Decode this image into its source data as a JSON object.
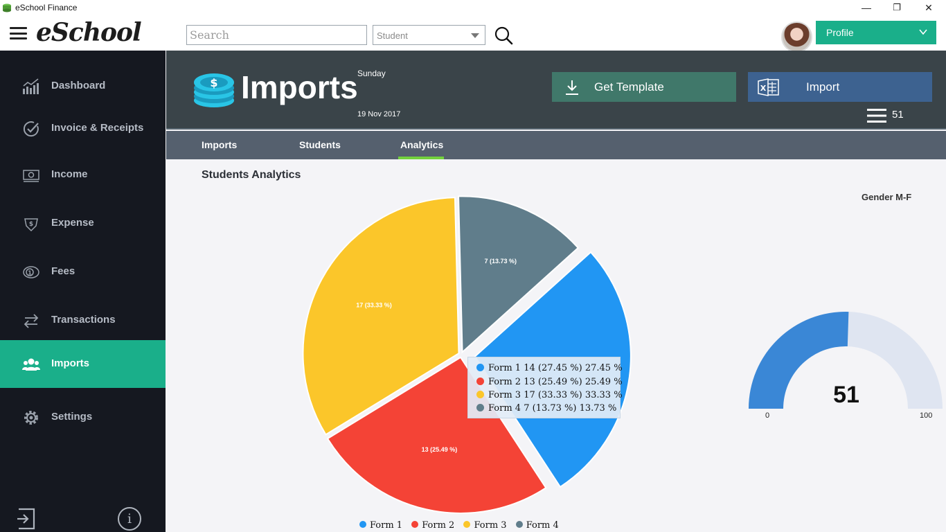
{
  "window": {
    "title": "eSchool Finance",
    "controls": {
      "minimize": "—",
      "maximize": "❐",
      "close": "✕"
    }
  },
  "header": {
    "logo": "eSchool",
    "search_placeholder": "Search",
    "role_select_value": "Student",
    "profile_label": "Profile"
  },
  "sidebar": {
    "items": [
      {
        "label": "Dashboard",
        "icon": "chart-icon",
        "active": false
      },
      {
        "label": "Invoice & Receipts",
        "icon": "check-circle-icon",
        "active": false
      },
      {
        "label": "Income",
        "icon": "money-icon",
        "active": false
      },
      {
        "label": "Expense",
        "icon": "expense-icon",
        "active": false
      },
      {
        "label": "Fees",
        "icon": "coin-icon",
        "active": false
      },
      {
        "label": "Transactions",
        "icon": "transfer-icon",
        "active": false
      },
      {
        "label": "Imports",
        "icon": "users-icon",
        "active": true
      },
      {
        "label": "Settings",
        "icon": "gear-icon",
        "active": false
      }
    ],
    "info_glyph": "i"
  },
  "banner": {
    "title": "Imports",
    "day": "Sunday",
    "date": "19 Nov 2017",
    "template_button": "Get Template",
    "import_button": "Import",
    "record_count": "51"
  },
  "tabs": [
    {
      "label": "Imports",
      "active": false
    },
    {
      "label": "Students",
      "active": false
    },
    {
      "label": "Analytics",
      "active": true
    }
  ],
  "content": {
    "section_title": "Students Analytics",
    "gauge_title": "Gender M-F",
    "gauge_value": "51",
    "gauge_min": "0",
    "gauge_max": "100"
  },
  "colors": {
    "accent_green": "#1aaf8a",
    "form1": "#2196f3",
    "form2": "#f44336",
    "form3": "#fbc62a",
    "form4": "#607d8b",
    "gauge_fill": "#3a87d6",
    "gauge_track": "#dfe5f1"
  },
  "tooltip": [
    {
      "text": "Form 1  14 (27.45 %)  27.45 %",
      "color": "#2196f3"
    },
    {
      "text": "Form 2  13 (25.49 %)  25.49 %",
      "color": "#f44336"
    },
    {
      "text": "Form 3  17 (33.33 %)  33.33 %",
      "color": "#fbc62a"
    },
    {
      "text": "Form 4  7 (13.73 %)     13.73 %",
      "color": "#607d8b"
    }
  ],
  "chart_data": {
    "type": "pie",
    "categories": [
      "Form 1",
      "Form 2",
      "Form 3",
      "Form 4"
    ],
    "values": [
      14,
      13,
      17,
      7
    ],
    "labels": [
      "",
      "13 (25.49 %)",
      "17 (33.33 %)",
      "7 (13.73 %)"
    ],
    "colors": [
      "#2196f3",
      "#f44336",
      "#fbc62a",
      "#607d8b"
    ],
    "exploded": "Form 1",
    "legend": "bottom"
  }
}
